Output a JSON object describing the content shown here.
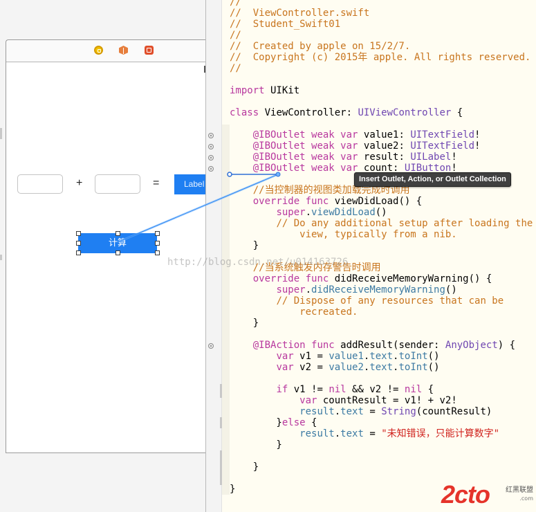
{
  "interface_builder": {
    "result_label": "Label",
    "plus_symbol": "+",
    "equals_symbol": "=",
    "calc_button": "计算",
    "dock_icons": [
      "view-controller-icon",
      "first-responder-icon",
      "exit-icon"
    ]
  },
  "editor": {
    "lines": [
      [
        {
          "c": "cm",
          "t": "//"
        }
      ],
      [
        {
          "c": "cm",
          "t": "//  ViewController.swift"
        }
      ],
      [
        {
          "c": "cm",
          "t": "//  Student_Swift01"
        }
      ],
      [
        {
          "c": "cm",
          "t": "//"
        }
      ],
      [
        {
          "c": "cm",
          "t": "//  Created by apple on 15/2/7."
        }
      ],
      [
        {
          "c": "cm",
          "t": "//  Copyright (c) 2015年 apple. All rights reserved."
        }
      ],
      [
        {
          "c": "cm",
          "t": "//"
        }
      ],
      [],
      [
        {
          "c": "kw",
          "t": "import"
        },
        {
          "t": " UIKit"
        }
      ],
      [],
      [
        {
          "c": "kw",
          "t": "class"
        },
        {
          "t": " ViewController: "
        },
        {
          "c": "ty",
          "t": "UIViewController"
        },
        {
          "t": " {"
        }
      ],
      [],
      [
        {
          "t": "    "
        },
        {
          "c": "kw",
          "t": "@IBOutlet"
        },
        {
          "t": " "
        },
        {
          "c": "kw",
          "t": "weak"
        },
        {
          "t": " "
        },
        {
          "c": "kw",
          "t": "var"
        },
        {
          "t": " value1: "
        },
        {
          "c": "ty",
          "t": "UITextField"
        },
        {
          "t": "!"
        }
      ],
      [
        {
          "t": "    "
        },
        {
          "c": "kw",
          "t": "@IBOutlet"
        },
        {
          "t": " "
        },
        {
          "c": "kw",
          "t": "weak"
        },
        {
          "t": " "
        },
        {
          "c": "kw",
          "t": "var"
        },
        {
          "t": " value2: "
        },
        {
          "c": "ty",
          "t": "UITextField"
        },
        {
          "t": "!"
        }
      ],
      [
        {
          "t": "    "
        },
        {
          "c": "kw",
          "t": "@IBOutlet"
        },
        {
          "t": " "
        },
        {
          "c": "kw",
          "t": "weak"
        },
        {
          "t": " "
        },
        {
          "c": "kw",
          "t": "var"
        },
        {
          "t": " result: "
        },
        {
          "c": "ty",
          "t": "UILabel"
        },
        {
          "t": "!"
        }
      ],
      [
        {
          "t": "    "
        },
        {
          "c": "kw",
          "t": "@IBOutlet"
        },
        {
          "t": " "
        },
        {
          "c": "kw",
          "t": "weak"
        },
        {
          "t": " "
        },
        {
          "c": "kw",
          "t": "var"
        },
        {
          "t": " count: "
        },
        {
          "c": "ty",
          "t": "UIButton"
        },
        {
          "t": "!"
        }
      ],
      [],
      [
        {
          "t": "    "
        },
        {
          "c": "cm",
          "t": "//当控制器的视图类加载完成时调用"
        }
      ],
      [
        {
          "t": "    "
        },
        {
          "c": "kw",
          "t": "override"
        },
        {
          "t": " "
        },
        {
          "c": "kw",
          "t": "func"
        },
        {
          "t": " viewDidLoad() {"
        }
      ],
      [
        {
          "t": "        "
        },
        {
          "c": "kw",
          "t": "super"
        },
        {
          "t": "."
        },
        {
          "c": "rf",
          "t": "viewDidLoad"
        },
        {
          "t": "()"
        }
      ],
      [
        {
          "t": "        "
        },
        {
          "c": "cm",
          "t": "// Do any additional setup after loading the"
        }
      ],
      [
        {
          "t": "            "
        },
        {
          "c": "cm",
          "t": "view, typically from a nib."
        }
      ],
      [
        {
          "t": "    }"
        }
      ],
      [],
      [
        {
          "t": "    "
        },
        {
          "c": "cm",
          "t": "//当系统触发内存警告时调用"
        }
      ],
      [
        {
          "t": "    "
        },
        {
          "c": "kw",
          "t": "override"
        },
        {
          "t": " "
        },
        {
          "c": "kw",
          "t": "func"
        },
        {
          "t": " didReceiveMemoryWarning() {"
        }
      ],
      [
        {
          "t": "        "
        },
        {
          "c": "kw",
          "t": "super"
        },
        {
          "t": "."
        },
        {
          "c": "rf",
          "t": "didReceiveMemoryWarning"
        },
        {
          "t": "()"
        }
      ],
      [
        {
          "t": "        "
        },
        {
          "c": "cm",
          "t": "// Dispose of any resources that can be"
        }
      ],
      [
        {
          "t": "            "
        },
        {
          "c": "cm",
          "t": "recreated."
        }
      ],
      [
        {
          "t": "    }"
        }
      ],
      [],
      [
        {
          "t": "    "
        },
        {
          "c": "kw",
          "t": "@IBAction"
        },
        {
          "t": " "
        },
        {
          "c": "kw",
          "t": "func"
        },
        {
          "t": " addResult(sender: "
        },
        {
          "c": "ty",
          "t": "AnyObject"
        },
        {
          "t": ") {"
        }
      ],
      [
        {
          "t": "        "
        },
        {
          "c": "kw",
          "t": "var"
        },
        {
          "t": " v1 = "
        },
        {
          "c": "rf",
          "t": "value1"
        },
        {
          "t": "."
        },
        {
          "c": "rf",
          "t": "text"
        },
        {
          "t": "."
        },
        {
          "c": "rf",
          "t": "toInt"
        },
        {
          "t": "()"
        }
      ],
      [
        {
          "t": "        "
        },
        {
          "c": "kw",
          "t": "var"
        },
        {
          "t": " v2 = "
        },
        {
          "c": "rf",
          "t": "value2"
        },
        {
          "t": "."
        },
        {
          "c": "rf",
          "t": "text"
        },
        {
          "t": "."
        },
        {
          "c": "rf",
          "t": "toInt"
        },
        {
          "t": "()"
        }
      ],
      [],
      [
        {
          "t": "        "
        },
        {
          "c": "kw",
          "t": "if"
        },
        {
          "t": " v1 != "
        },
        {
          "c": "kw",
          "t": "nil"
        },
        {
          "t": " && v2 != "
        },
        {
          "c": "kw",
          "t": "nil"
        },
        {
          "t": " {"
        }
      ],
      [
        {
          "t": "            "
        },
        {
          "c": "kw",
          "t": "var"
        },
        {
          "t": " countResult = v1! + v2!"
        }
      ],
      [
        {
          "t": "            "
        },
        {
          "c": "rf",
          "t": "result"
        },
        {
          "t": "."
        },
        {
          "c": "rf",
          "t": "text"
        },
        {
          "t": " = "
        },
        {
          "c": "ty",
          "t": "String"
        },
        {
          "t": "(countResult)"
        }
      ],
      [
        {
          "t": "        }"
        },
        {
          "c": "kw",
          "t": "else"
        },
        {
          "t": " {"
        }
      ],
      [
        {
          "t": "            "
        },
        {
          "c": "rf",
          "t": "result"
        },
        {
          "t": "."
        },
        {
          "c": "rf",
          "t": "text"
        },
        {
          "t": " = "
        },
        {
          "c": "st",
          "t": "\"未知错误，只能计算数字\""
        }
      ],
      [
        {
          "t": "        }"
        }
      ],
      [],
      [
        {
          "t": "    }"
        }
      ],
      [],
      [
        {
          "t": "}"
        }
      ]
    ]
  },
  "tooltip": "Insert Outlet, Action, or Outlet Collection",
  "watermark": "http://blog.csdn.net/u014163726",
  "logo": {
    "main": "2cto",
    "sub_cn": "红黑联盟",
    "sub_en": ".com"
  },
  "colors": {
    "comment": "#c8751e",
    "keyword": "#b8379e",
    "type": "#6f46b1",
    "reference": "#3c7aa3",
    "string": "#d0231e",
    "ib_blue": "#1f7ff2"
  }
}
